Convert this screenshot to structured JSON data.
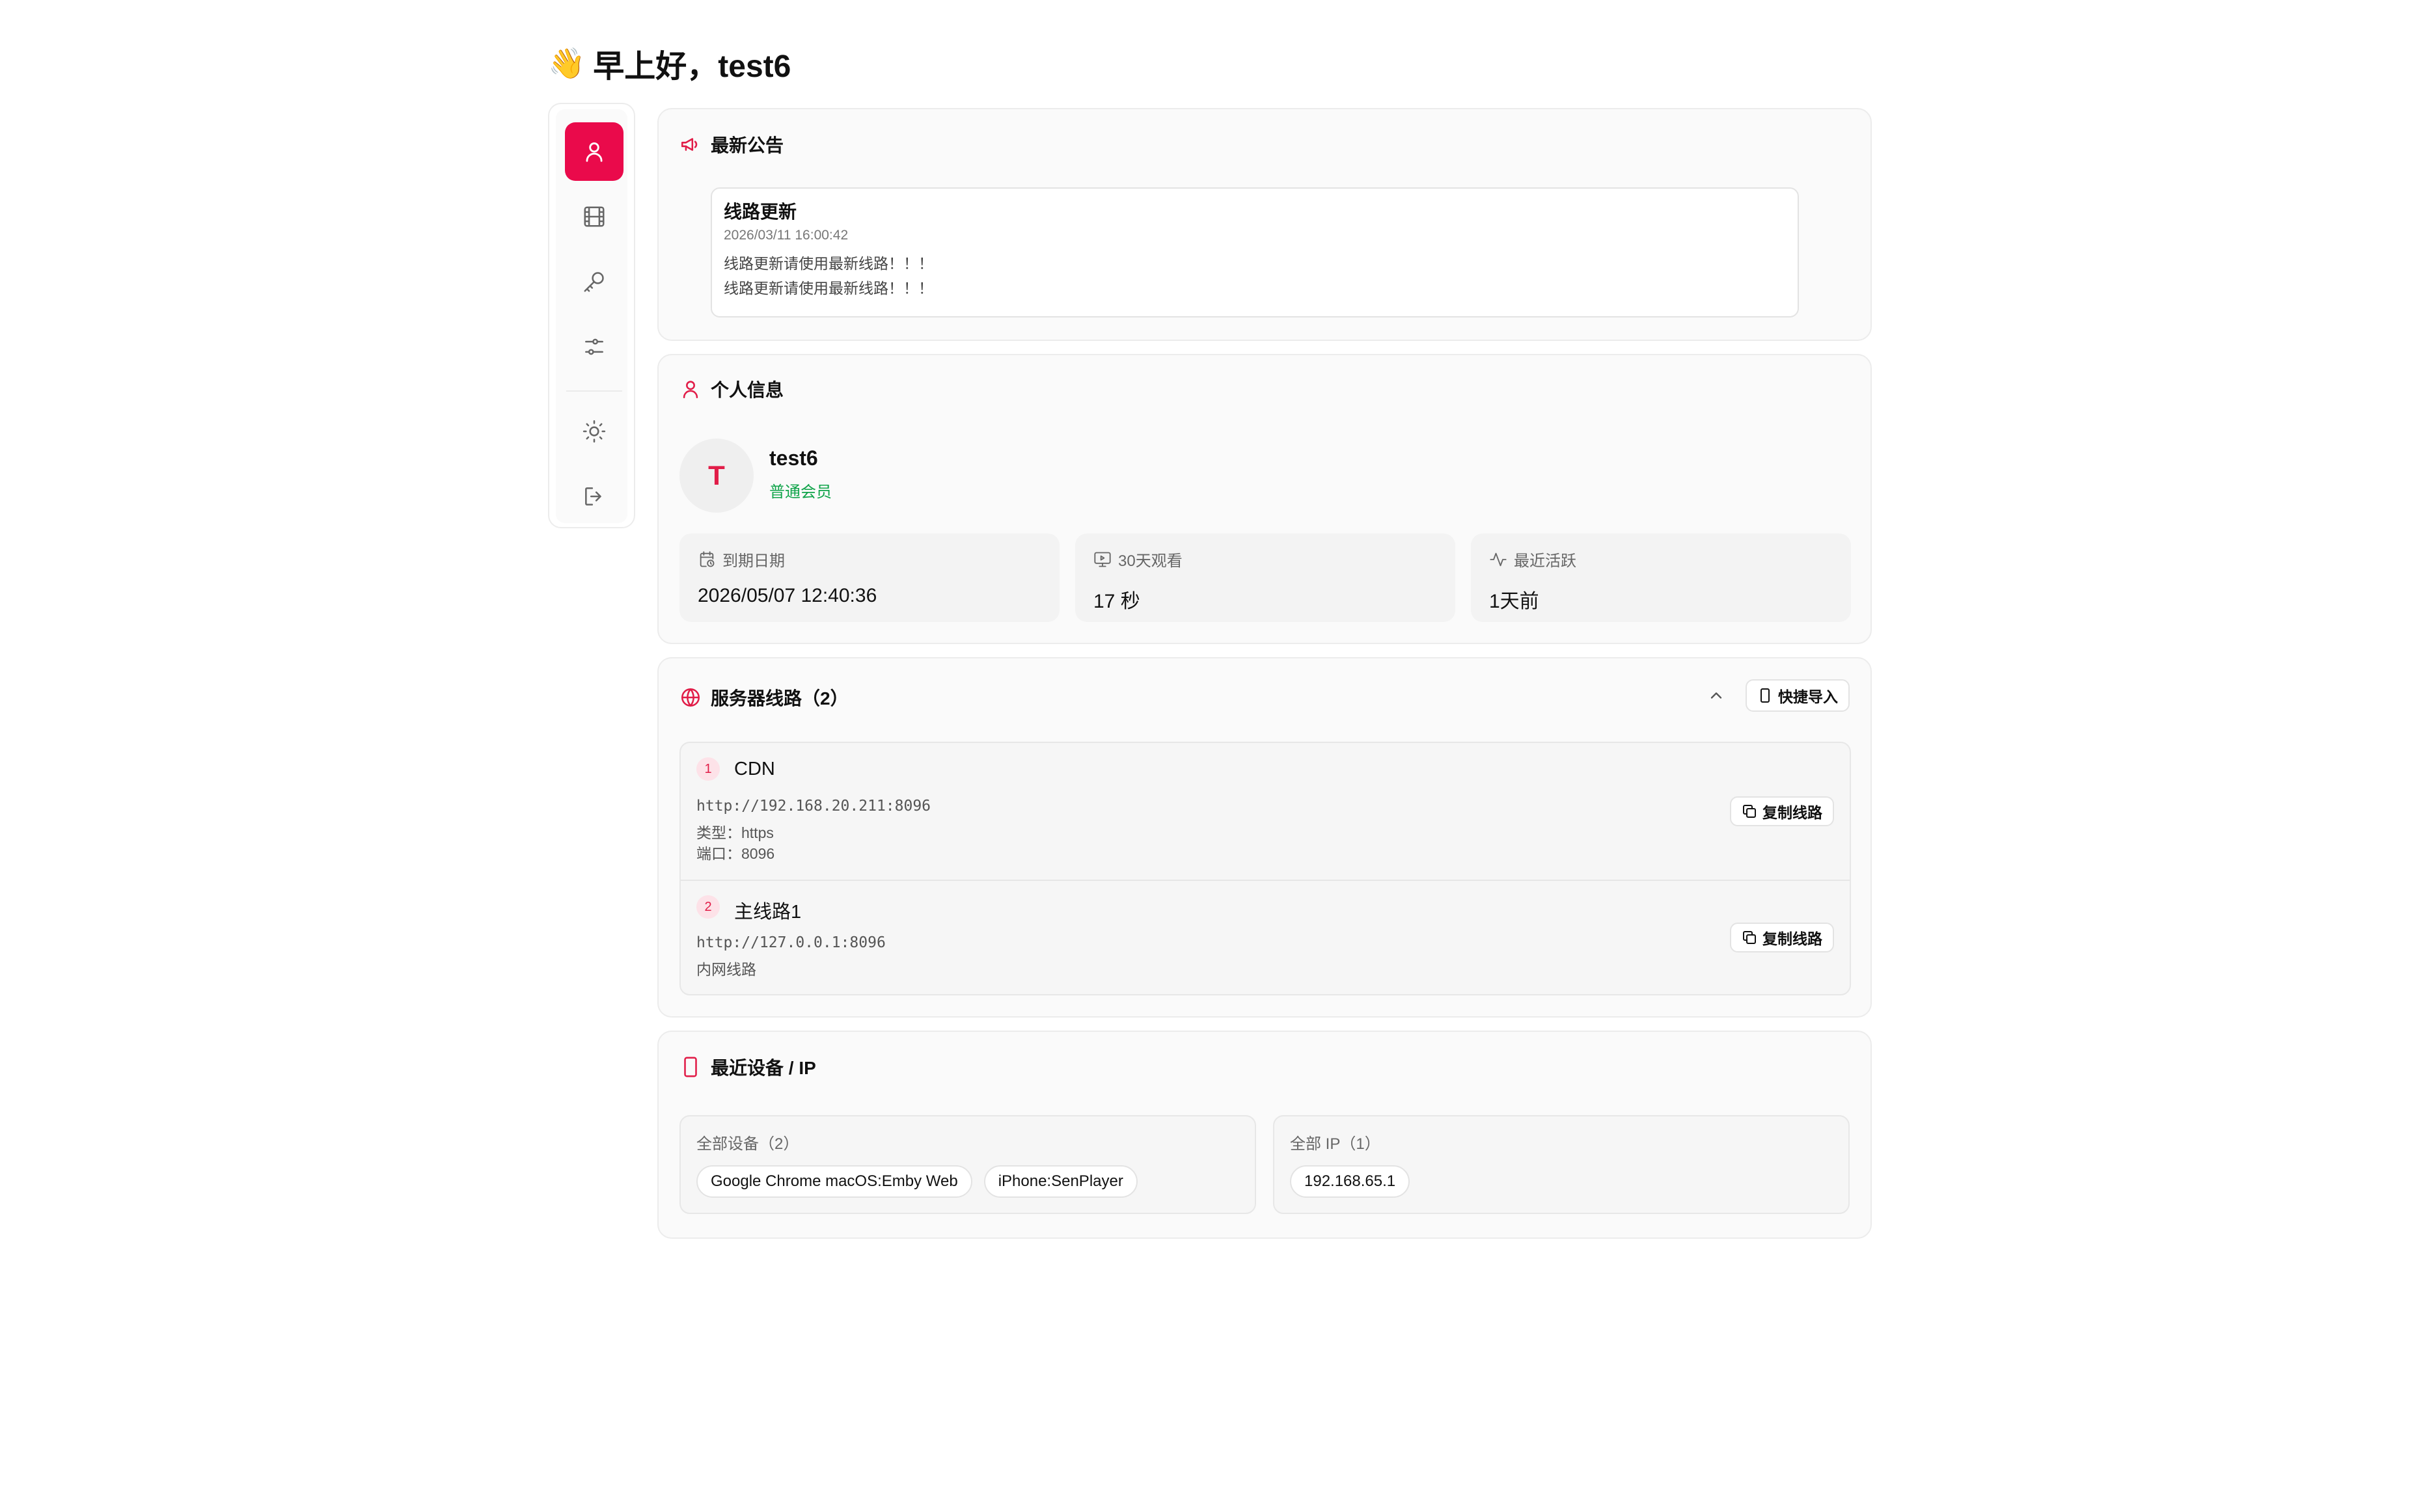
{
  "greeting": {
    "emoji": "👋",
    "text": "早上好，test6"
  },
  "sidebar": {
    "items": [
      {
        "id": "profile",
        "icon": "user-icon",
        "active": true
      },
      {
        "id": "media",
        "icon": "film-icon",
        "active": false
      },
      {
        "id": "keys",
        "icon": "key-icon",
        "active": false
      },
      {
        "id": "settings",
        "icon": "sliders-icon",
        "active": false
      },
      {
        "id": "theme",
        "icon": "sun-icon",
        "active": false
      },
      {
        "id": "logout",
        "icon": "logout-icon",
        "active": false
      }
    ]
  },
  "announcements": {
    "title": "最新公告",
    "icon": "megaphone-icon",
    "items": [
      {
        "title": "线路更新",
        "date": "2026/03/11 16:00:42",
        "lines": [
          "线路更新请使用最新线路！！！",
          "线路更新请使用最新线路！！！"
        ]
      }
    ]
  },
  "profile": {
    "title": "个人信息",
    "icon": "user-icon",
    "avatar_letter": "T",
    "username": "test6",
    "role": "普通会员",
    "stats": [
      {
        "icon": "calendar-clock-icon",
        "label": "到期日期",
        "value": "2026/05/07 12:40:36"
      },
      {
        "icon": "monitor-play-icon",
        "label": "30天观看",
        "value": "17 秒"
      },
      {
        "icon": "activity-icon",
        "label": "最近活跃",
        "value": "1天前"
      }
    ]
  },
  "servers": {
    "title": "服务器线路（2）",
    "icon": "globe-icon",
    "import_label": "快捷导入",
    "copy_label": "复制线路",
    "items": [
      {
        "num": "1",
        "name": "CDN",
        "url": "http://192.168.20.211:8096",
        "meta": [
          "类型：https",
          "端口：8096"
        ]
      },
      {
        "num": "2",
        "name": "主线路1",
        "url": "http://127.0.0.1:8096",
        "meta": [
          "内网线路"
        ]
      }
    ]
  },
  "devices": {
    "title": "最近设备 / IP",
    "icon": "smartphone-icon",
    "devices_label": "全部设备（2）",
    "device_list": [
      "Google Chrome macOS:Emby Web",
      "iPhone:SenPlayer"
    ],
    "ip_label": "全部 IP（1）",
    "ip_list": [
      "192.168.65.1"
    ]
  },
  "colors": {
    "accent": "#ea0a4b",
    "role_green": "#10a44a"
  }
}
